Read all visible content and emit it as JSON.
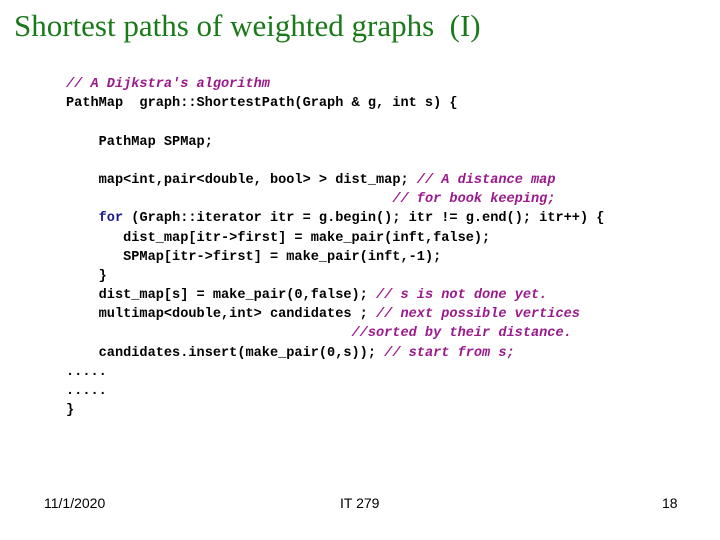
{
  "slide": {
    "title": "Shortest paths of weighted graphs  (I)",
    "code_lines": [
      {
        "indent": "",
        "code": "",
        "comment": "// A Dijkstra's algorithm"
      },
      {
        "indent": "",
        "code": "PathMap  graph::ShortestPath(Graph & g, int s) {",
        "comment": ""
      },
      {
        "indent": "",
        "code": "",
        "comment": ""
      },
      {
        "indent": "    ",
        "code": "PathMap SPMap;",
        "comment": ""
      },
      {
        "indent": "",
        "code": "",
        "comment": ""
      },
      {
        "indent": "    ",
        "code": "map<int,pair<double, bool> > dist_map; ",
        "comment": "// A distance map"
      },
      {
        "indent": "                                        ",
        "code": "",
        "comment": "// for book keeping;"
      },
      {
        "indent": "    ",
        "keyword": "for",
        "code": " (Graph::iterator itr = g.begin(); itr != g.end(); itr++) {",
        "comment": ""
      },
      {
        "indent": "       ",
        "code": "dist_map[itr->first] = make_pair(inft,false);",
        "comment": ""
      },
      {
        "indent": "       ",
        "code": "SPMap[itr->first] = make_pair(inft,-1);",
        "comment": ""
      },
      {
        "indent": "    ",
        "code": "}",
        "comment": ""
      },
      {
        "indent": "    ",
        "code": "dist_map[s] = make_pair(0,false); ",
        "comment": "// s is not done yet."
      },
      {
        "indent": "    ",
        "code": "multimap<double,int> candidates ; ",
        "comment": "// next possible vertices"
      },
      {
        "indent": "                                   ",
        "code": "",
        "comment": "//sorted by their distance."
      },
      {
        "indent": "    ",
        "code": "candidates.insert(make_pair(0,s)); ",
        "comment": "// start from s;"
      },
      {
        "indent": "",
        "code": ".....",
        "comment": ""
      },
      {
        "indent": "",
        "code": ".....",
        "comment": ""
      },
      {
        "indent": "",
        "code": "}",
        "comment": ""
      }
    ]
  },
  "footer": {
    "date": "11/1/2020",
    "course": "IT 279",
    "page": "18"
  },
  "colors": {
    "title": "#1a7a1a",
    "comment": "#9a1a8c",
    "keyword": "#1a1a8c",
    "code": "#000000"
  }
}
